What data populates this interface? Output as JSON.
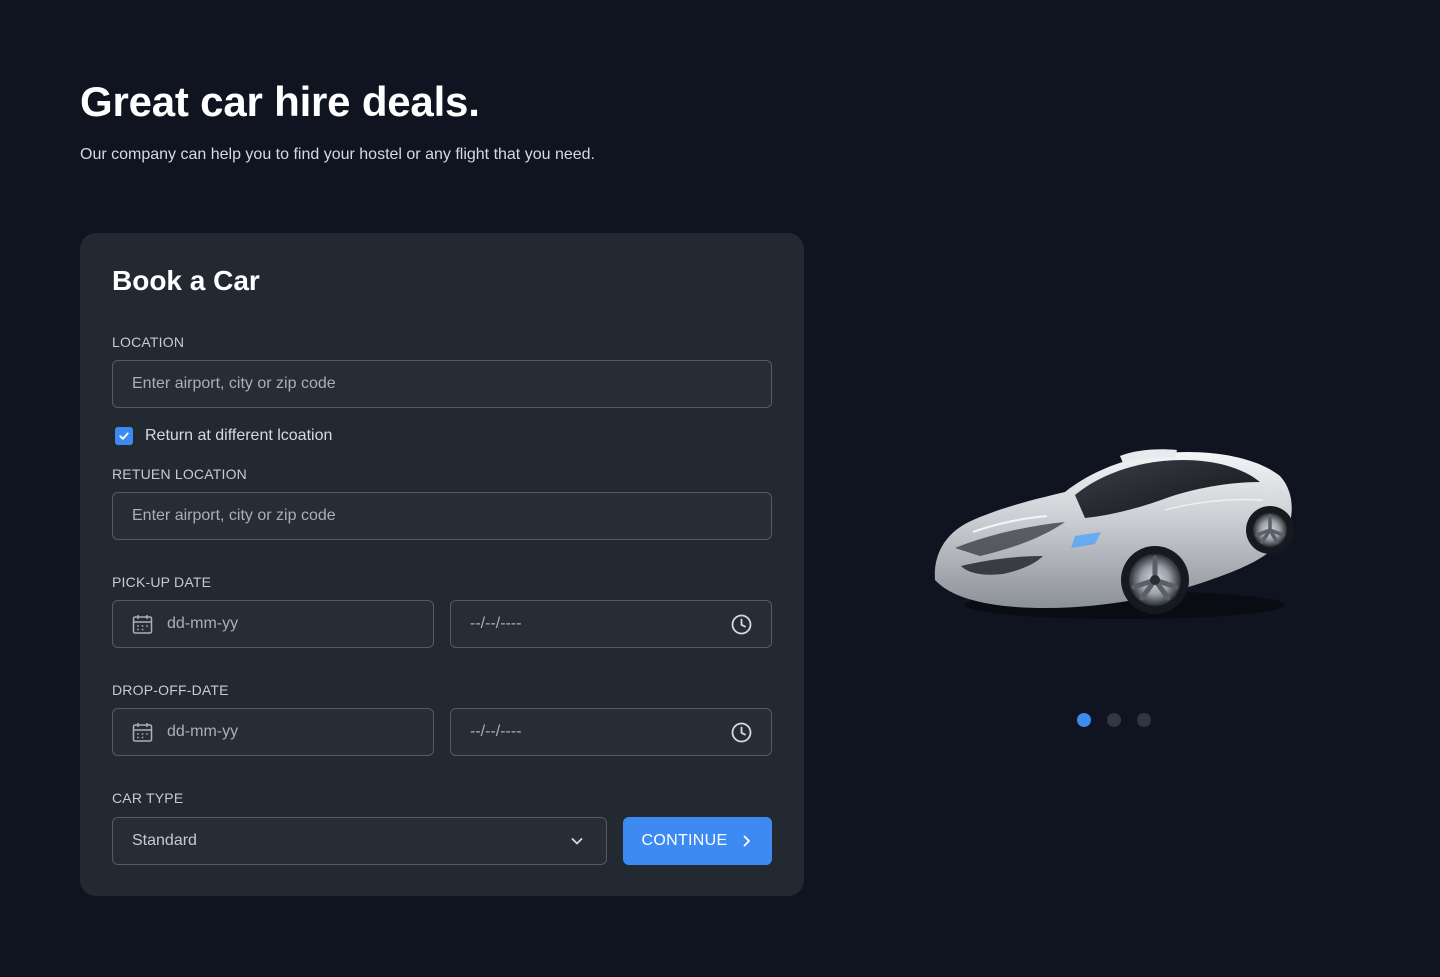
{
  "hero": {
    "title": "Great car hire deals.",
    "subtitle": "Our company can help you to find your hostel or any flight that you need."
  },
  "booking": {
    "title": "Book a Car",
    "location": {
      "label": "LOCATION",
      "placeholder": "Enter airport, city or zip code",
      "value": ""
    },
    "return_checkbox": {
      "label": "Return at different lcoation",
      "checked": true
    },
    "return_location": {
      "label": "RETUEN LOCATION",
      "placeholder": "Enter airport, city or zip code",
      "value": ""
    },
    "pickup": {
      "label": "PICK-UP DATE",
      "date_placeholder": "dd-mm-yy",
      "time_placeholder": "--/--/----"
    },
    "dropoff": {
      "label": "DROP-OFF-DATE",
      "date_placeholder": "dd-mm-yy",
      "time_placeholder": "--/--/----"
    },
    "car_type": {
      "label": "CAR TYPE",
      "selected": "Standard"
    },
    "continue_label": "CONTINUE"
  },
  "carousel": {
    "slide_count": 3,
    "active_index": 0,
    "image": "silver-sports-car"
  },
  "icons": {
    "checkbox": "check-icon",
    "date": "calendar-icon",
    "time": "clock-icon",
    "select": "chevron-down-icon",
    "continue": "chevron-right-icon"
  },
  "colors": {
    "background": "#0f1420",
    "card": "#222930",
    "accent": "#3d8bf2",
    "dot_inactive": "#313842"
  }
}
